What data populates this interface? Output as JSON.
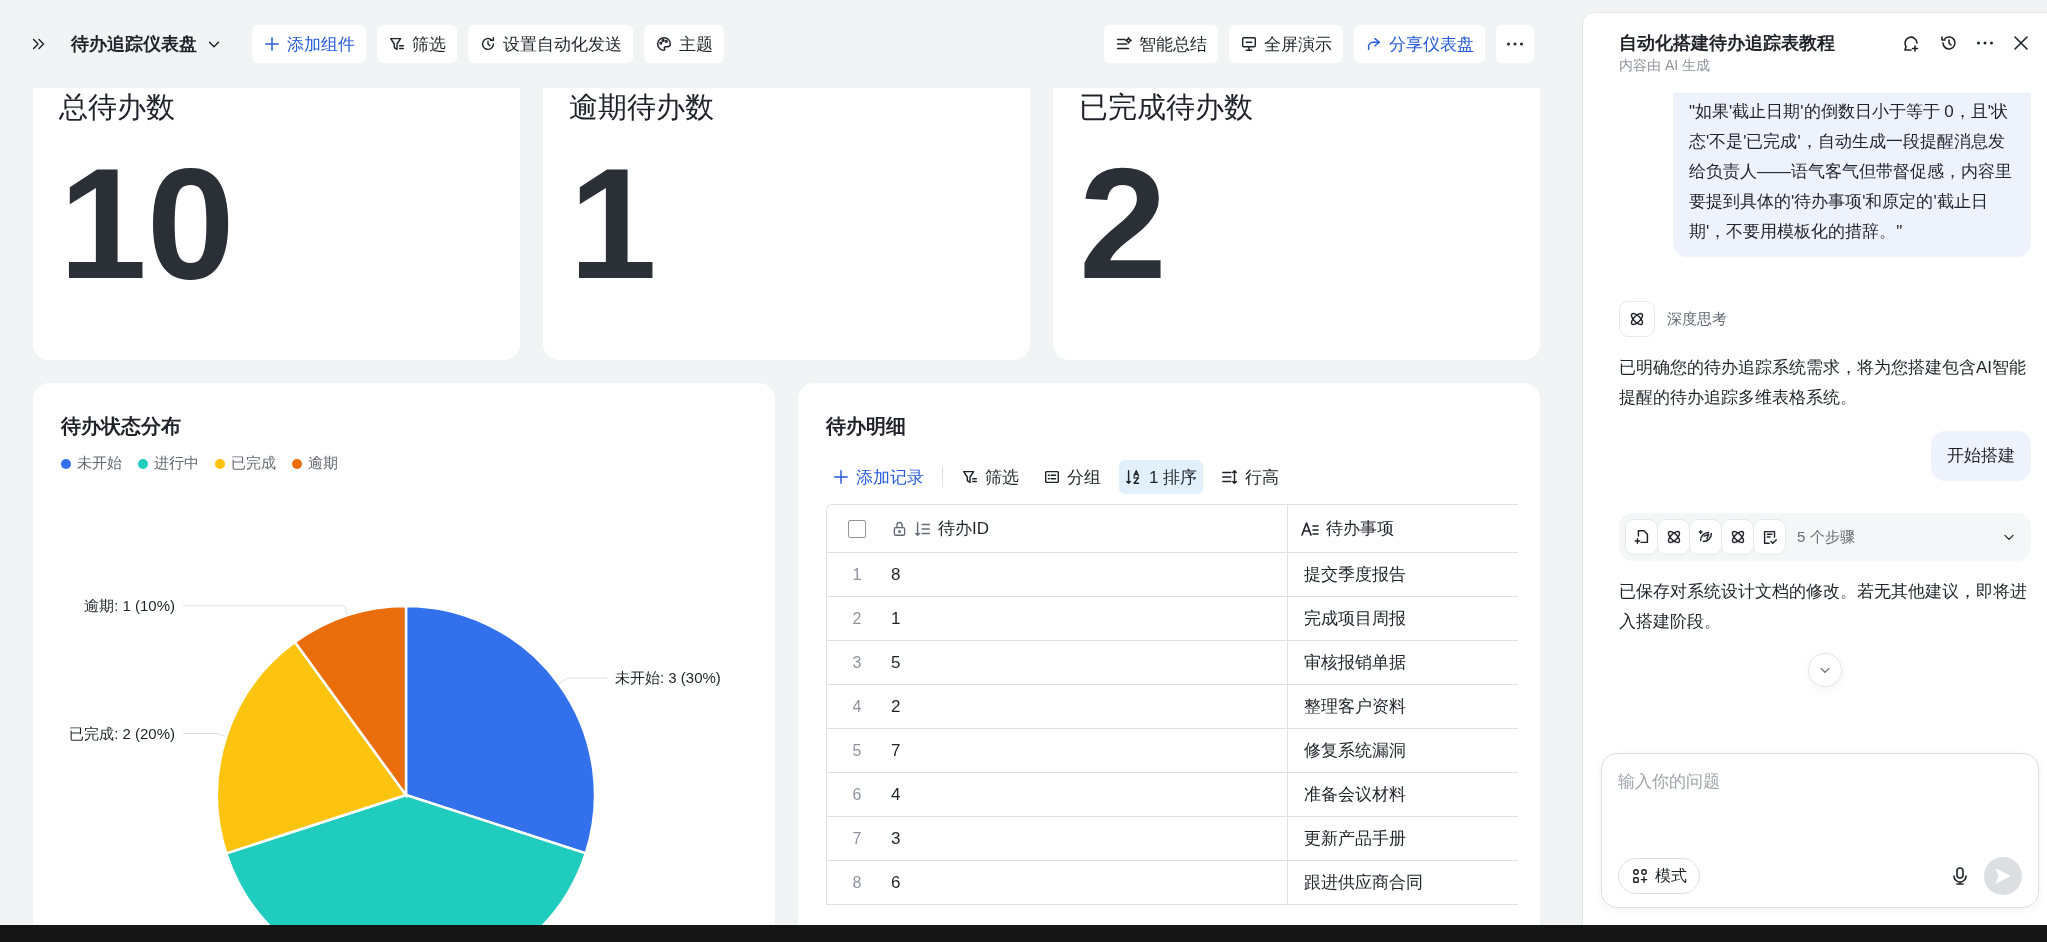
{
  "toolbar": {
    "title": "待办追踪仪表盘",
    "left_buttons": [
      {
        "kind": "add",
        "label": "添加组件"
      },
      {
        "kind": "filter",
        "label": "筛选"
      },
      {
        "kind": "automation",
        "label": "设置自动化发送"
      },
      {
        "kind": "theme",
        "label": "主题"
      }
    ],
    "right_buttons": [
      {
        "kind": "summary",
        "label": "智能总结"
      },
      {
        "kind": "present",
        "label": "全屏演示"
      },
      {
        "kind": "share",
        "label": "分享仪表盘"
      },
      {
        "kind": "more"
      }
    ]
  },
  "stats": [
    {
      "title": "总待办数",
      "value": "10"
    },
    {
      "title": "逾期待办数",
      "value": "1"
    },
    {
      "title": "已完成待办数",
      "value": "2"
    }
  ],
  "status_chart": {
    "title": "待办状态分布",
    "legend": [
      {
        "color": "#3370eb"
      },
      {
        "color": "#1fccbd"
      },
      {
        "color": "#fcc30f"
      },
      {
        "color": "#e96d0b"
      }
    ],
    "chart_data": {
      "type": "pie",
      "categories": [
        "未开始",
        "进行中",
        "已完成",
        "逾期"
      ],
      "values": [
        3,
        4,
        2,
        1
      ],
      "value_labels": [
        "未开始: 3 (30%)",
        null,
        "已完成: 2 (20%)",
        "逾期: 1 (10%)"
      ]
    }
  },
  "detail_table": {
    "title": "待办明细",
    "tools": [
      {
        "kind": "add",
        "label": "添加记录",
        "active": false
      },
      {
        "kind": "filter",
        "label": "筛选",
        "active": false
      },
      {
        "kind": "group",
        "label": "分组",
        "active": false
      },
      {
        "kind": "sort",
        "label": "1 排序",
        "active": true
      },
      {
        "kind": "row-height",
        "label": "行高",
        "active": false
      }
    ],
    "select_all": {
      "checked": false
    },
    "columns": [
      {
        "kind": "number",
        "label": "待办ID"
      },
      {
        "kind": "text",
        "label": "待办事项"
      }
    ],
    "rows": [
      {
        "index": "1",
        "cells": [
          "8",
          "提交季度报告"
        ]
      },
      {
        "index": "2",
        "cells": [
          "1",
          "完成项目周报"
        ]
      },
      {
        "index": "3",
        "cells": [
          "5",
          "审核报销单据"
        ]
      },
      {
        "index": "4",
        "cells": [
          "2",
          "整理客户资料"
        ]
      },
      {
        "index": "5",
        "cells": [
          "7",
          "修复系统漏洞"
        ]
      },
      {
        "index": "6",
        "cells": [
          "4",
          "准备会议材料"
        ]
      },
      {
        "index": "7",
        "cells": [
          "3",
          "更新产品手册"
        ]
      },
      {
        "index": "8",
        "cells": [
          "6",
          "跟进供应商合同"
        ]
      }
    ]
  },
  "assistant": {
    "title": "自动化搭建待办追踪表教程",
    "subtitle": "内容由 AI 生成",
    "messages": [
      {
        "kind": "user",
        "text": "\"如果'截止日期'的倒数日小于等于 0，且'状态'不是'已完成'，自动生成一段提醒消息发给负责人——语气客气但带督促感，内容里要提到具体的'待办事项'和原定的'截止日期'，不要用模板化的措辞。\""
      },
      {
        "kind": "thinking",
        "text": "深度思考"
      },
      {
        "kind": "ai",
        "text": "已明确您的待办追踪系统需求，将为您搭建包含AI智能提醒的待办追踪多维表格系统。"
      },
      {
        "kind": "user",
        "text": "开始搭建"
      },
      {
        "kind": "steps",
        "text": "5 个步骤"
      },
      {
        "kind": "ai",
        "text": "已保存对系统设计文档的修改。若无其他建议，即将进入搭建阶段。"
      }
    ],
    "input": {
      "placeholder": "输入你的问题",
      "mode_button": "模式"
    }
  }
}
